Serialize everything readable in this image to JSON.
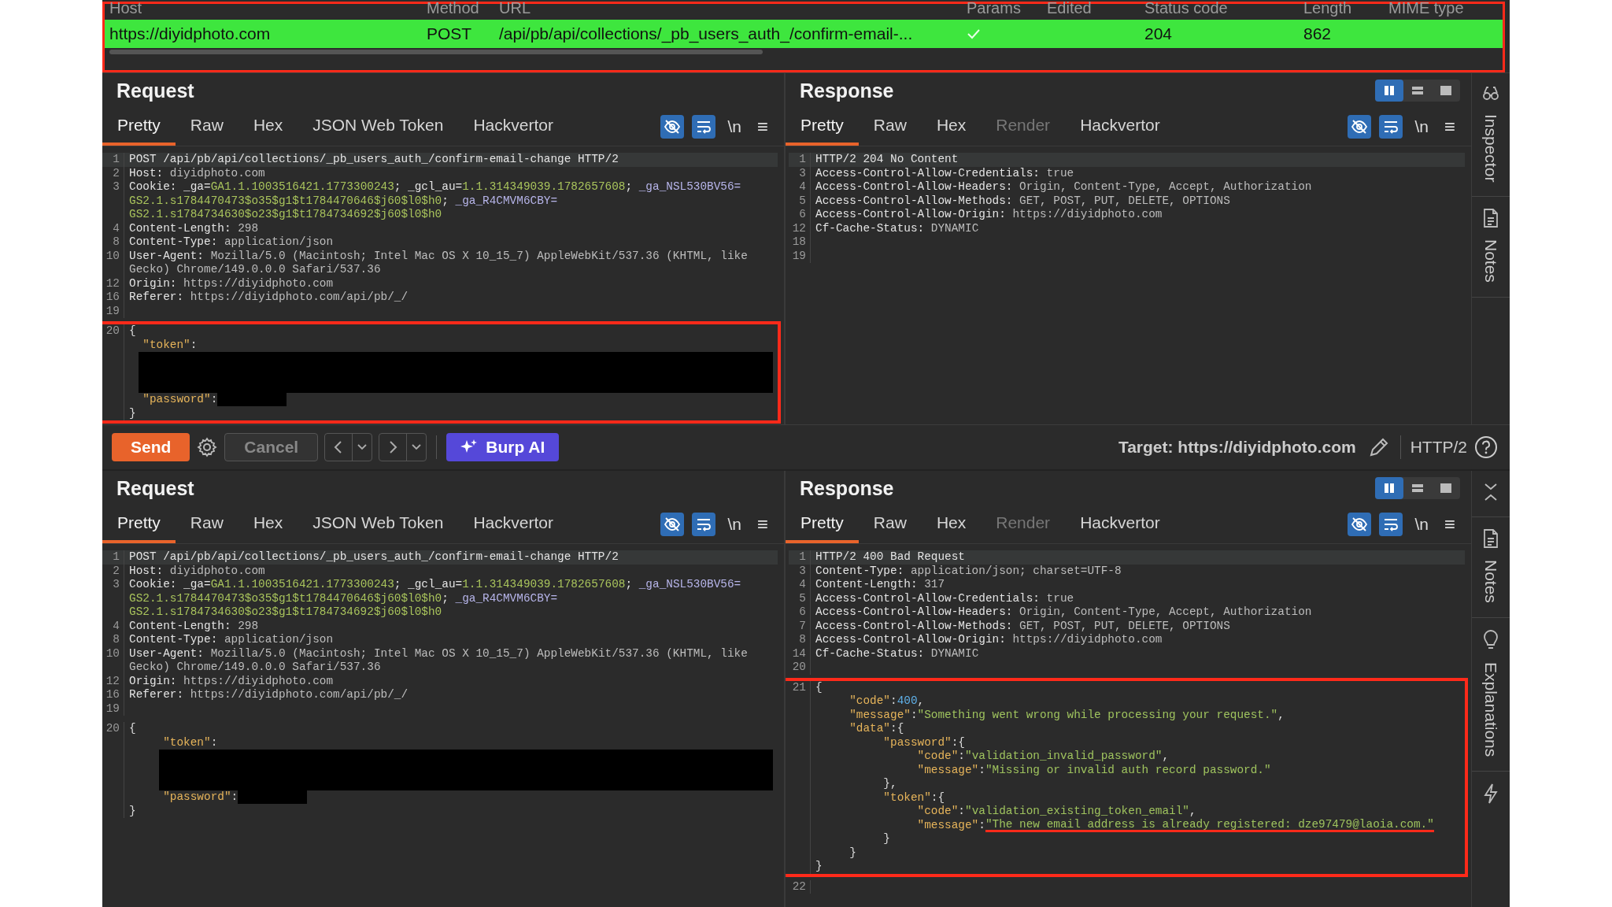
{
  "history": {
    "annotated": true,
    "columns": [
      "Host",
      "Method",
      "URL",
      "Params",
      "Edited",
      "Status code",
      "Length",
      "MIME type"
    ],
    "row": {
      "selected": true,
      "host": "https://diyidphoto.com",
      "method": "POST",
      "url": "/api/pb/api/collections/_pb_users_auth_/confirm-email-...",
      "params_checked": true,
      "status": "204",
      "length": "862"
    }
  },
  "sections": [
    {
      "request": {
        "title": "Request",
        "tabs": [
          {
            "label": "Pretty",
            "selected": true,
            "disabled": false
          },
          {
            "label": "Raw",
            "selected": false,
            "disabled": false
          },
          {
            "label": "Hex",
            "selected": false,
            "disabled": false
          },
          {
            "label": "JSON Web Token",
            "selected": false,
            "disabled": false
          },
          {
            "label": "Hackvertor",
            "selected": false,
            "disabled": false
          }
        ],
        "tools": [
          {
            "kind": "hide",
            "on": true
          },
          {
            "kind": "wrap",
            "on": true
          },
          {
            "kind": "newline",
            "label": "\\n"
          },
          {
            "kind": "menu",
            "label": "≡"
          }
        ],
        "code": {
          "body_annotated": true,
          "header_lines": [
            {
              "num": "1",
              "current": true,
              "parts": [
                {
                  "kind": "name",
                  "text": "POST /api/pb/api/collections/_pb_users_auth_/confirm-email-change HTTP/2"
                }
              ]
            },
            {
              "num": "2",
              "current": false,
              "parts": [
                {
                  "kind": "name",
                  "text": "Host:"
                },
                {
                  "kind": "value",
                  "text": " diyidphoto.com"
                }
              ]
            },
            {
              "num": "3",
              "current": false,
              "parts": [
                {
                  "kind": "name",
                  "text": "Cookie: _ga="
                },
                {
                  "kind": "green",
                  "text": "GA1.1.1003516421.1773300243"
                },
                {
                  "kind": "name",
                  "text": "; _gcl_au="
                },
                {
                  "kind": "green",
                  "text": "1.1.314349039.1782657608"
                },
                {
                  "kind": "name",
                  "text": "; "
                },
                {
                  "kind": "attr",
                  "text": "_ga_NSL530BV56="
                }
              ]
            },
            {
              "current": false,
              "parts": [
                {
                  "kind": "green",
                  "text": "GS2.1.s1784470473$o35$g1$t1784470646$j60$l0$h0"
                },
                {
                  "kind": "name",
                  "text": "; "
                },
                {
                  "kind": "attr",
                  "text": "_ga_R4CMVM6CBY="
                }
              ]
            },
            {
              "current": false,
              "parts": [
                {
                  "kind": "green",
                  "text": "GS2.1.s1784734630$o23$g1$t1784734692$j60$l0$h0"
                }
              ]
            },
            {
              "num": "4",
              "current": false,
              "parts": [
                {
                  "kind": "name",
                  "text": "Content-Length:"
                },
                {
                  "kind": "value",
                  "text": " 298"
                }
              ]
            },
            {
              "num": "8",
              "current": false,
              "parts": [
                {
                  "kind": "name",
                  "text": "Content-Type:"
                },
                {
                  "kind": "value",
                  "text": " application/json"
                }
              ]
            },
            {
              "num": "10",
              "current": false,
              "parts": [
                {
                  "kind": "name",
                  "text": "User-Agent:"
                },
                {
                  "kind": "value",
                  "text": " Mozilla/5.0 (Macintosh; Intel Mac OS X 10_15_7) AppleWebKit/537.36 (KHTML, like"
                }
              ]
            },
            {
              "current": false,
              "parts": [
                {
                  "kind": "value",
                  "text": "Gecko) Chrome/149.0.0.0 Safari/537.36"
                }
              ]
            },
            {
              "num": "12",
              "current": false,
              "parts": [
                {
                  "kind": "name",
                  "text": "Origin:"
                },
                {
                  "kind": "value",
                  "text": " https://diyidphoto.com"
                }
              ]
            },
            {
              "num": "16",
              "current": false,
              "parts": [
                {
                  "kind": "name",
                  "text": "Referer:"
                },
                {
                  "kind": "value",
                  "text": " https://diyidphoto.com/api/pb/_/"
                }
              ]
            },
            {
              "num": "19",
              "current": false
            }
          ],
          "body_lines": [
            {
              "num": "20",
              "current": false,
              "parts": [
                {
                  "kind": "plain",
                  "text": "{"
                }
              ]
            },
            {
              "current": false,
              "parts": [
                {
                  "kind": "key",
                  "text": "  \"token\""
                },
                {
                  "kind": "plain",
                  "text": ":"
                }
              ]
            },
            {
              "current": false,
              "kind": "redacted-wide"
            },
            {
              "current": false,
              "parts": [
                {
                  "kind": "key",
                  "text": "  \"password\""
                },
                {
                  "kind": "plain",
                  "text": ":"
                },
                {
                  "kind": "redacted"
                }
              ]
            },
            {
              "current": false,
              "parts": [
                {
                  "kind": "plain",
                  "text": "}"
                }
              ]
            }
          ]
        }
      },
      "response": {
        "title": "Response",
        "views": [
          {
            "kind": "columns",
            "selected": true
          },
          {
            "kind": "rows",
            "selected": false
          },
          {
            "kind": "single",
            "selected": false
          }
        ],
        "tabs": [
          {
            "label": "Pretty",
            "selected": true,
            "disabled": false
          },
          {
            "label": "Raw",
            "selected": false,
            "disabled": false
          },
          {
            "label": "Hex",
            "selected": false,
            "disabled": false
          },
          {
            "label": "Render",
            "selected": false,
            "disabled": true
          },
          {
            "label": "Hackvertor",
            "selected": false,
            "disabled": false
          }
        ],
        "tools": [
          {
            "kind": "hide",
            "on": true
          },
          {
            "kind": "wrap",
            "on": true
          },
          {
            "kind": "newline",
            "label": "\\n"
          },
          {
            "kind": "menu",
            "label": "≡"
          }
        ],
        "code": {
          "header_lines": [
            {
              "num": "1",
              "current": true,
              "parts": [
                {
                  "kind": "name",
                  "text": "HTTP/2 204 No Content"
                }
              ]
            },
            {
              "num": "3",
              "current": false,
              "parts": [
                {
                  "kind": "name",
                  "text": "Access-Control-Allow-Credentials:"
                },
                {
                  "kind": "value",
                  "text": " true"
                }
              ]
            },
            {
              "num": "4",
              "current": false,
              "parts": [
                {
                  "kind": "name",
                  "text": "Access-Control-Allow-Headers:"
                },
                {
                  "kind": "value",
                  "text": " Origin, Content-Type, Accept, Authorization"
                }
              ]
            },
            {
              "num": "5",
              "current": false,
              "parts": [
                {
                  "kind": "name",
                  "text": "Access-Control-Allow-Methods:"
                },
                {
                  "kind": "value",
                  "text": " GET, POST, PUT, DELETE, OPTIONS"
                }
              ]
            },
            {
              "num": "6",
              "current": false,
              "parts": [
                {
                  "kind": "name",
                  "text": "Access-Control-Allow-Origin:"
                },
                {
                  "kind": "value",
                  "text": " https://diyidphoto.com"
                }
              ]
            },
            {
              "num": "12",
              "current": false,
              "parts": [
                {
                  "kind": "name",
                  "text": "Cf-Cache-Status:"
                },
                {
                  "kind": "value",
                  "text": " DYNAMIC"
                }
              ]
            },
            {
              "num": "18",
              "current": false
            },
            {
              "num": "19",
              "current": false
            }
          ]
        }
      },
      "sidebar": [
        {
          "kind": "inspector",
          "label": "Inspector"
        },
        {
          "kind": "notes",
          "label": "Notes"
        },
        {
          "kind": "blank"
        }
      ]
    },
    {
      "request": {
        "title": "Request",
        "tabs": [
          {
            "label": "Pretty",
            "selected": true,
            "disabled": false
          },
          {
            "label": "Raw",
            "selected": false,
            "disabled": false
          },
          {
            "label": "Hex",
            "selected": false,
            "disabled": false
          },
          {
            "label": "JSON Web Token",
            "selected": false,
            "disabled": false
          },
          {
            "label": "Hackvertor",
            "selected": false,
            "disabled": false
          }
        ],
        "tools": [
          {
            "kind": "hide",
            "on": true
          },
          {
            "kind": "wrap",
            "on": true
          },
          {
            "kind": "newline",
            "label": "\\n"
          },
          {
            "kind": "menu",
            "label": "≡"
          }
        ],
        "code": {
          "body_annotated": false,
          "header_lines": [
            {
              "num": "1",
              "current": true,
              "parts": [
                {
                  "kind": "name",
                  "text": "POST /api/pb/api/collections/_pb_users_auth_/confirm-email-change HTTP/2"
                }
              ]
            },
            {
              "num": "2",
              "current": false,
              "parts": [
                {
                  "kind": "name",
                  "text": "Host:"
                },
                {
                  "kind": "value",
                  "text": " diyidphoto.com"
                }
              ]
            },
            {
              "num": "3",
              "current": false,
              "parts": [
                {
                  "kind": "name",
                  "text": "Cookie: _ga="
                },
                {
                  "kind": "green",
                  "text": "GA1.1.1003516421.1773300243"
                },
                {
                  "kind": "name",
                  "text": "; _gcl_au="
                },
                {
                  "kind": "green",
                  "text": "1.1.314349039.1782657608"
                },
                {
                  "kind": "name",
                  "text": "; "
                },
                {
                  "kind": "attr",
                  "text": "_ga_NSL530BV56="
                }
              ]
            },
            {
              "current": false,
              "parts": [
                {
                  "kind": "green",
                  "text": "GS2.1.s1784470473$o35$g1$t1784470646$j60$l0$h0"
                },
                {
                  "kind": "name",
                  "text": "; "
                },
                {
                  "kind": "attr",
                  "text": "_ga_R4CMVM6CBY="
                }
              ]
            },
            {
              "current": false,
              "parts": [
                {
                  "kind": "green",
                  "text": "GS2.1.s1784734630$o23$g1$t1784734692$j60$l0$h0"
                }
              ]
            },
            {
              "num": "4",
              "current": false,
              "parts": [
                {
                  "kind": "name",
                  "text": "Content-Length:"
                },
                {
                  "kind": "value",
                  "text": " 298"
                }
              ]
            },
            {
              "num": "8",
              "current": false,
              "parts": [
                {
                  "kind": "name",
                  "text": "Content-Type:"
                },
                {
                  "kind": "value",
                  "text": " application/json"
                }
              ]
            },
            {
              "num": "10",
              "current": false,
              "parts": [
                {
                  "kind": "name",
                  "text": "User-Agent:"
                },
                {
                  "kind": "value",
                  "text": " Mozilla/5.0 (Macintosh; Intel Mac OS X 10_15_7) AppleWebKit/537.36 (KHTML, like"
                }
              ]
            },
            {
              "current": false,
              "parts": [
                {
                  "kind": "value",
                  "text": "Gecko) Chrome/149.0.0.0 Safari/537.36"
                }
              ]
            },
            {
              "num": "12",
              "current": false,
              "parts": [
                {
                  "kind": "name",
                  "text": "Origin:"
                },
                {
                  "kind": "value",
                  "text": " https://diyidphoto.com"
                }
              ]
            },
            {
              "num": "16",
              "current": false,
              "parts": [
                {
                  "kind": "name",
                  "text": "Referer:"
                },
                {
                  "kind": "value",
                  "text": " https://diyidphoto.com/api/pb/_/"
                }
              ]
            },
            {
              "num": "19",
              "current": false
            }
          ],
          "body_lines": [
            {
              "num": "20",
              "current": false,
              "parts": [
                {
                  "kind": "plain",
                  "text": "{"
                }
              ]
            },
            {
              "current": false,
              "parts": [
                {
                  "kind": "key",
                  "text": "     \"token\""
                },
                {
                  "kind": "plain",
                  "text": ":"
                }
              ]
            },
            {
              "current": false,
              "kind": "redacted-indented"
            },
            {
              "current": false,
              "parts": [
                {
                  "kind": "key",
                  "text": "     \"password\""
                },
                {
                  "kind": "plain",
                  "text": ":"
                },
                {
                  "kind": "redacted"
                }
              ]
            },
            {
              "current": false,
              "parts": [
                {
                  "kind": "plain",
                  "text": "}"
                }
              ]
            }
          ]
        }
      },
      "response": {
        "title": "Response",
        "views": [
          {
            "kind": "columns",
            "selected": true
          },
          {
            "kind": "rows",
            "selected": false
          },
          {
            "kind": "single",
            "selected": false
          }
        ],
        "tabs": [
          {
            "label": "Pretty",
            "selected": true,
            "disabled": false
          },
          {
            "label": "Raw",
            "selected": false,
            "disabled": false
          },
          {
            "label": "Hex",
            "selected": false,
            "disabled": false
          },
          {
            "label": "Render",
            "selected": false,
            "disabled": true
          },
          {
            "label": "Hackvertor",
            "selected": false,
            "disabled": false
          }
        ],
        "tools": [
          {
            "kind": "hide",
            "on": true
          },
          {
            "kind": "wrap",
            "on": true
          },
          {
            "kind": "newline",
            "label": "\\n"
          },
          {
            "kind": "menu",
            "label": "≡"
          }
        ],
        "code": {
          "body_annotated": true,
          "header_lines": [
            {
              "num": "1",
              "current": true,
              "parts": [
                {
                  "kind": "name",
                  "text": "HTTP/2 400 Bad Request"
                }
              ]
            },
            {
              "num": "3",
              "current": false,
              "parts": [
                {
                  "kind": "name",
                  "text": "Content-Type:"
                },
                {
                  "kind": "value",
                  "text": " application/json; charset=UTF-8"
                }
              ]
            },
            {
              "num": "4",
              "current": false,
              "parts": [
                {
                  "kind": "name",
                  "text": "Content-Length:"
                },
                {
                  "kind": "value",
                  "text": " 317"
                }
              ]
            },
            {
              "num": "5",
              "current": false,
              "parts": [
                {
                  "kind": "name",
                  "text": "Access-Control-Allow-Credentials:"
                },
                {
                  "kind": "value",
                  "text": " true"
                }
              ]
            },
            {
              "num": "6",
              "current": false,
              "parts": [
                {
                  "kind": "name",
                  "text": "Access-Control-Allow-Headers:"
                },
                {
                  "kind": "value",
                  "text": " Origin, Content-Type, Accept, Authorization"
                }
              ]
            },
            {
              "num": "7",
              "current": false,
              "parts": [
                {
                  "kind": "name",
                  "text": "Access-Control-Allow-Methods:"
                },
                {
                  "kind": "value",
                  "text": " GET, POST, PUT, DELETE, OPTIONS"
                }
              ]
            },
            {
              "num": "8",
              "current": false,
              "parts": [
                {
                  "kind": "name",
                  "text": "Access-Control-Allow-Origin:"
                },
                {
                  "kind": "value",
                  "text": " https://diyidphoto.com"
                }
              ]
            },
            {
              "num": "14",
              "current": false,
              "parts": [
                {
                  "kind": "name",
                  "text": "Cf-Cache-Status:"
                },
                {
                  "kind": "value",
                  "text": " DYNAMIC"
                }
              ]
            },
            {
              "num": "20",
              "current": false
            }
          ],
          "body_lines": [
            {
              "num": "21",
              "current": false,
              "parts": [
                {
                  "kind": "plain",
                  "text": "{"
                }
              ]
            },
            {
              "current": false,
              "parts": [
                {
                  "kind": "key",
                  "text": "     \"code\""
                },
                {
                  "kind": "plain",
                  "text": ":"
                },
                {
                  "kind": "number",
                  "text": "400"
                },
                {
                  "kind": "plain",
                  "text": ","
                }
              ]
            },
            {
              "current": false,
              "parts": [
                {
                  "kind": "key",
                  "text": "     \"message\""
                },
                {
                  "kind": "plain",
                  "text": ":"
                },
                {
                  "kind": "string",
                  "text": "\"Something went wrong while processing your request.\""
                },
                {
                  "kind": "plain",
                  "text": ","
                }
              ]
            },
            {
              "current": false,
              "parts": [
                {
                  "kind": "key",
                  "text": "     \"data\""
                },
                {
                  "kind": "plain",
                  "text": ":{"
                }
              ]
            },
            {
              "current": false,
              "parts": [
                {
                  "kind": "key",
                  "text": "          \"password\""
                },
                {
                  "kind": "plain",
                  "text": ":{"
                }
              ]
            },
            {
              "current": false,
              "parts": [
                {
                  "kind": "key",
                  "text": "               \"code\""
                },
                {
                  "kind": "plain",
                  "text": ":"
                },
                {
                  "kind": "string",
                  "text": "\"validation_invalid_password\""
                },
                {
                  "kind": "plain",
                  "text": ","
                }
              ]
            },
            {
              "current": false,
              "parts": [
                {
                  "kind": "key",
                  "text": "               \"message\""
                },
                {
                  "kind": "plain",
                  "text": ":"
                },
                {
                  "kind": "string",
                  "text": "\"Missing or invalid auth record password.\""
                }
              ]
            },
            {
              "current": false,
              "parts": [
                {
                  "kind": "plain",
                  "text": "          },"
                }
              ]
            },
            {
              "current": false,
              "parts": [
                {
                  "kind": "key",
                  "text": "          \"token\""
                },
                {
                  "kind": "plain",
                  "text": ":{"
                }
              ]
            },
            {
              "current": false,
              "parts": [
                {
                  "kind": "key",
                  "text": "               \"code\""
                },
                {
                  "kind": "plain",
                  "text": ":"
                },
                {
                  "kind": "string",
                  "text": "\"validation_existing_token_email\""
                },
                {
                  "kind": "plain",
                  "text": ","
                }
              ]
            },
            {
              "current": false,
              "parts": [
                {
                  "kind": "key",
                  "text": "               \"message\""
                },
                {
                  "kind": "plain",
                  "text": ":"
                },
                {
                  "kind": "string",
                  "text": "\"The new email address is already registered: dze97479@laoia.com.\"",
                  "underlined": true
                }
              ]
            },
            {
              "current": false,
              "parts": [
                {
                  "kind": "plain",
                  "text": "          }"
                }
              ]
            },
            {
              "current": false,
              "parts": [
                {
                  "kind": "plain",
                  "text": "     }"
                }
              ]
            },
            {
              "current": false,
              "parts": [
                {
                  "kind": "plain",
                  "text": "}"
                }
              ]
            }
          ],
          "tail_lines": [
            {
              "num": "22",
              "current": false
            }
          ]
        }
      },
      "sidebar": [
        {
          "kind": "collapse"
        },
        {
          "kind": "notes",
          "label": "Notes"
        },
        {
          "kind": "explanations",
          "label": "Explanations"
        },
        {
          "kind": "actions"
        }
      ]
    }
  ],
  "toolbar": {
    "send": "Send",
    "cancel": {
      "label": "Cancel",
      "disabled": true
    },
    "burp_ai": "Burp AI",
    "target": "Target: https://diyidphoto.com",
    "protocol": "HTTP/2"
  }
}
